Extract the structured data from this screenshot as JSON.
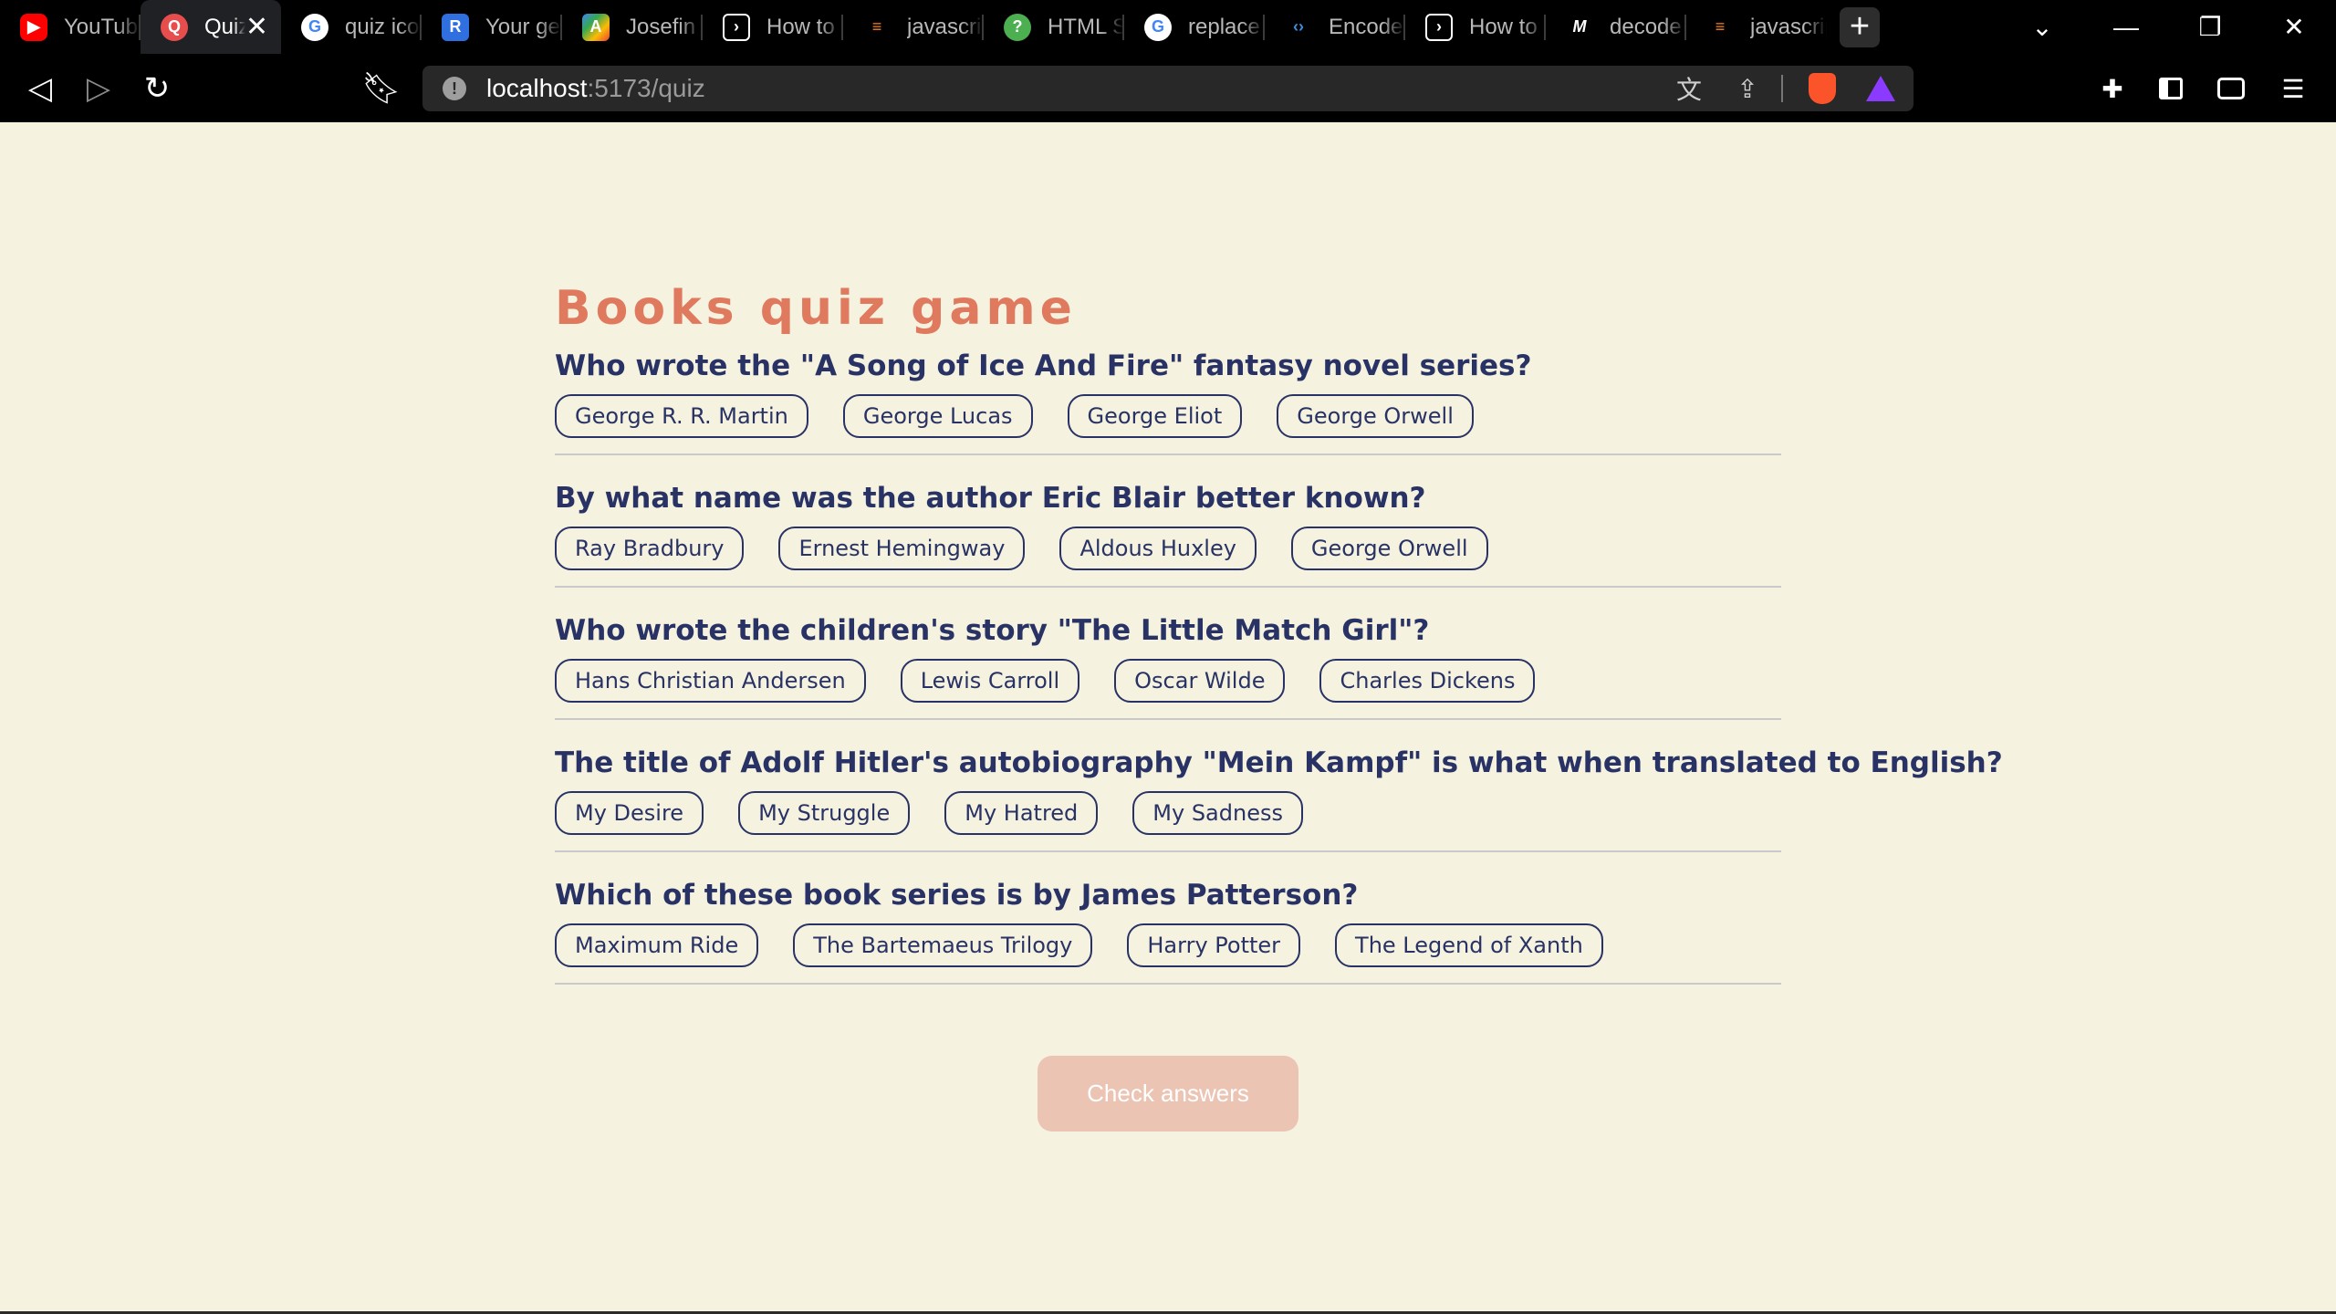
{
  "browser": {
    "tabs": [
      {
        "label": "YouTube",
        "icon": "youtube-icon",
        "color": "#ff0000"
      },
      {
        "label": "Quiz",
        "icon": "quiz-app-icon",
        "color": "#e84d4d",
        "active": true
      },
      {
        "label": "quiz icon",
        "icon": "google-icon",
        "color": "#ffffff"
      },
      {
        "label": "Your gen",
        "icon": "r-logo-icon",
        "color": "#2f6fe0"
      },
      {
        "label": "Josefin",
        "icon": "google-fonts-icon",
        "color": "#4285f4"
      },
      {
        "label": "How to",
        "icon": "terminal-icon",
        "color": "#ffffff"
      },
      {
        "label": "javascript",
        "icon": "stackoverflow-icon",
        "color": "#f48024"
      },
      {
        "label": "HTML S",
        "icon": "help-icon",
        "color": "#4caf50"
      },
      {
        "label": "replace",
        "icon": "google-icon",
        "color": "#ffffff"
      },
      {
        "label": "Encode",
        "icon": "code-icon",
        "color": "#3c8dde"
      },
      {
        "label": "How to",
        "icon": "terminal-icon",
        "color": "#ffffff"
      },
      {
        "label": "decode",
        "icon": "mdn-icon",
        "color": "#ffffff"
      },
      {
        "label": "javascript",
        "icon": "stackoverflow-icon",
        "color": "#f48024"
      }
    ],
    "url_host": "localhost",
    "url_path": ":5173/quiz"
  },
  "quiz": {
    "title": "Books quiz game",
    "questions": [
      {
        "text": "Who wrote the \"A Song of Ice And Fire\" fantasy novel series?",
        "answers": [
          "George R. R. Martin",
          "George Lucas",
          "George Eliot",
          "George Orwell"
        ]
      },
      {
        "text": "By what name was the author Eric Blair better known?",
        "answers": [
          "Ray Bradbury",
          "Ernest Hemingway",
          "Aldous Huxley",
          "George Orwell"
        ]
      },
      {
        "text": "Who wrote the children's story \"The Little Match Girl\"?",
        "answers": [
          "Hans Christian Andersen",
          "Lewis Carroll",
          "Oscar Wilde",
          "Charles Dickens"
        ]
      },
      {
        "text": "The title of Adolf Hitler's autobiography \"Mein Kampf\" is what when translated to English?",
        "answers": [
          "My Desire",
          "My Struggle",
          "My Hatred",
          "My Sadness"
        ]
      },
      {
        "text": "Which of these book series is by James Patterson?",
        "answers": [
          "Maximum Ride",
          "The Bartemaeus Trilogy",
          "Harry Potter",
          "The Legend of Xanth"
        ]
      }
    ],
    "check_label": "Check answers"
  },
  "colors": {
    "title": "#e07a5f",
    "text": "#293264",
    "background": "#f5f2e0",
    "button_disabled": "#ebc4b4"
  }
}
